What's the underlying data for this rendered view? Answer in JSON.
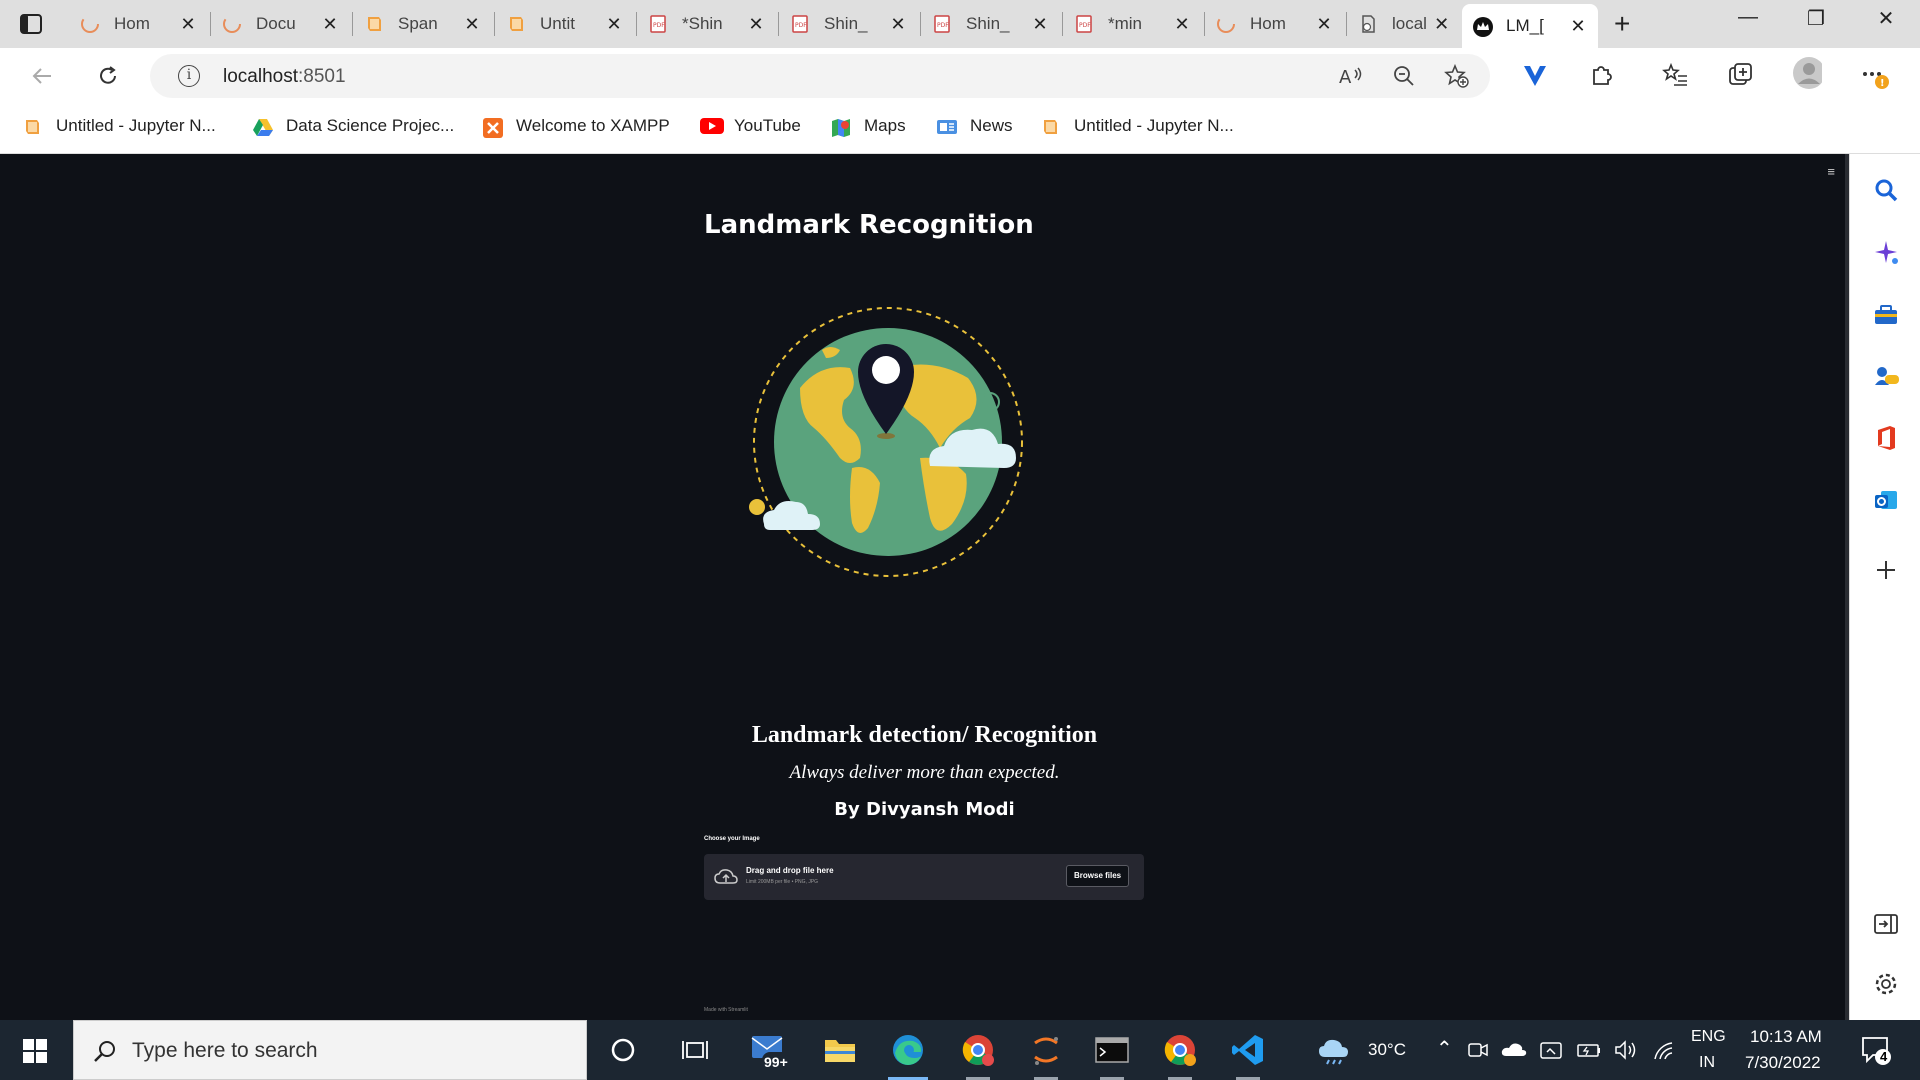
{
  "browser": {
    "tabs": [
      {
        "title": "Hom",
        "icon": "loading-spinner-icon"
      },
      {
        "title": "Docu",
        "icon": "loading-spinner-icon"
      },
      {
        "title": "Span",
        "icon": "jupyter-book-icon"
      },
      {
        "title": "Untit",
        "icon": "jupyter-book-icon"
      },
      {
        "title": "*Shin",
        "icon": "pdf-icon"
      },
      {
        "title": "Shin_",
        "icon": "pdf-icon"
      },
      {
        "title": "Shin_",
        "icon": "pdf-icon"
      },
      {
        "title": "*min",
        "icon": "pdf-icon"
      },
      {
        "title": "Hom",
        "icon": "loading-spinner-icon"
      },
      {
        "title": "local",
        "icon": "error-page-icon"
      },
      {
        "title": "LM_[",
        "icon": "streamlit-crown-icon",
        "active": true
      }
    ],
    "address": {
      "host": "localhost",
      "port": ":8501"
    },
    "bookmarks": [
      {
        "label": "Untitled - Jupyter N...",
        "icon": "jupyter-book-icon"
      },
      {
        "label": "Data Science Projec...",
        "icon": "google-drive-icon"
      },
      {
        "label": "Welcome to XAMPP",
        "icon": "xampp-icon"
      },
      {
        "label": "YouTube",
        "icon": "youtube-icon"
      },
      {
        "label": "Maps",
        "icon": "maps-icon"
      },
      {
        "label": "News",
        "icon": "news-icon"
      },
      {
        "label": "Untitled - Jupyter N...",
        "icon": "jupyter-book-icon"
      }
    ]
  },
  "app": {
    "title": "Landmark Recognition",
    "heading": "Landmark detection/ Recognition",
    "tagline": "Always deliver more than expected.",
    "author": "By Divyansh Modi",
    "uploader": {
      "label": "Choose your Image",
      "drag_text": "Drag and drop file here",
      "limit_text": "Limit 200MB per file • PNG, JPG",
      "button": "Browse files"
    },
    "footer": "Made with Streamlit"
  },
  "taskbar": {
    "search_placeholder": "Type here to search",
    "mail_badge": "99+",
    "weather": "30°C",
    "lang_top": "ENG",
    "lang_bottom": "IN",
    "time": "10:13 AM",
    "date": "7/30/2022",
    "notif_count": "4"
  },
  "colors": {
    "page_bg": "#0e1117",
    "globe_ocean": "#5aa37d",
    "globe_land": "#e9c13a",
    "pin": "#141628",
    "cloud": "#dff2f7"
  }
}
